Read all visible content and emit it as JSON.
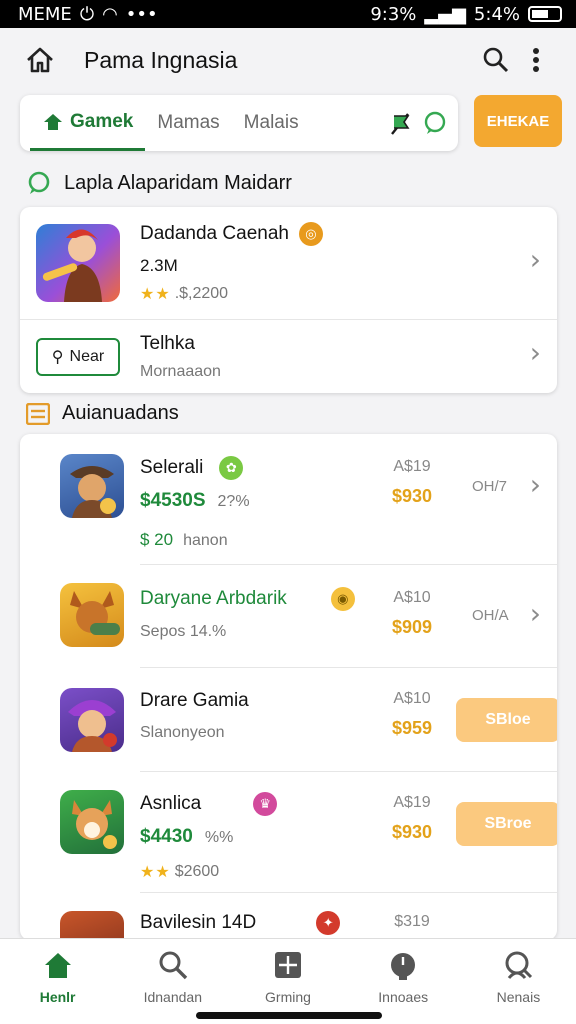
{
  "status_bar": {
    "left_text": "MEME",
    "time": "9:3%",
    "battery": "5:4%"
  },
  "header": {
    "title": "Pama Ingnasia"
  },
  "tabs": [
    {
      "label": "Gamek",
      "active": true
    },
    {
      "label": "Mamas",
      "active": false
    },
    {
      "label": "Malais",
      "active": false
    }
  ],
  "action_button": {
    "label": "EHEKAE"
  },
  "featured": {
    "heading": "Lapla Alaparidam Maidarr",
    "items": [
      {
        "name": "Dadanda Caenah",
        "size": "2.3M",
        "rating": "2",
        "rating_text": ".$,2200"
      },
      {
        "tag": "Near",
        "name": "Telhka",
        "subtitle": "Mornaaaon"
      }
    ]
  },
  "list": {
    "heading": "Auianuadans",
    "items": [
      {
        "name": "Selerali",
        "promo": "$4530S",
        "promo_note": "2?%",
        "extra": "$ 20",
        "extra_note": "hanon",
        "price_small": "A$19",
        "price": "$930",
        "aux": "OH/7",
        "accent": "#35a852"
      },
      {
        "name": "Daryane Arbdarik",
        "subtitle": "Sepos 14.%",
        "price_small": "A$10",
        "price": "$909",
        "aux": "OH/A",
        "accent": "#e3a21a"
      },
      {
        "name": "Drare Gamia",
        "subtitle": "Slanonyeon",
        "price_small": "A$10",
        "price": "$959",
        "button": "SBloe",
        "accent": "#8b4fb3"
      },
      {
        "name": "Asnlica",
        "promo": "$4430",
        "promo_note": "%%",
        "rating": "2",
        "rating_text": "$2600",
        "price_small": "A$19",
        "price": "$930",
        "button": "SBroe",
        "accent": "#d24a9c"
      },
      {
        "name": "Bavilesin 14D",
        "price_small": "$319",
        "accent": "#d33a2c"
      }
    ]
  },
  "bottom_nav": [
    {
      "label": "Henlr",
      "icon": "home-icon",
      "active": true
    },
    {
      "label": "Idnandan",
      "icon": "search-icon",
      "active": false
    },
    {
      "label": "Grming",
      "icon": "grid-icon",
      "active": false
    },
    {
      "label": "Innoaes",
      "icon": "timer-icon",
      "active": false
    },
    {
      "label": "Nenais",
      "icon": "user-icon",
      "active": false
    }
  ]
}
